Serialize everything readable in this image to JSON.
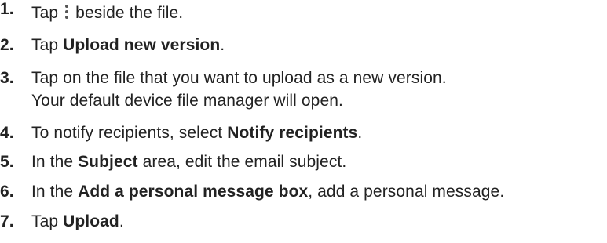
{
  "steps": [
    {
      "num": "1.",
      "before": "Tap",
      "icon": "more-vertical-icon",
      "after": "beside the file."
    },
    {
      "num": "2.",
      "before": "Tap ",
      "bold": "Upload new version",
      "after": "."
    },
    {
      "num": "3.",
      "line1": "Tap on the file that you want to upload as a new version.",
      "line2": "Your default device file manager will open."
    },
    {
      "num": "4.",
      "before": "To notify recipients, select ",
      "bold": "Notify recipients",
      "after": "."
    },
    {
      "num": "5.",
      "before": "In the ",
      "bold": "Subject",
      "after": " area, edit the email subject."
    },
    {
      "num": "6.",
      "before": "In the ",
      "bold": "Add a personal message box",
      "after": ", add a personal message."
    },
    {
      "num": "7.",
      "before": "Tap ",
      "bold": "Upload",
      "after": "."
    }
  ]
}
